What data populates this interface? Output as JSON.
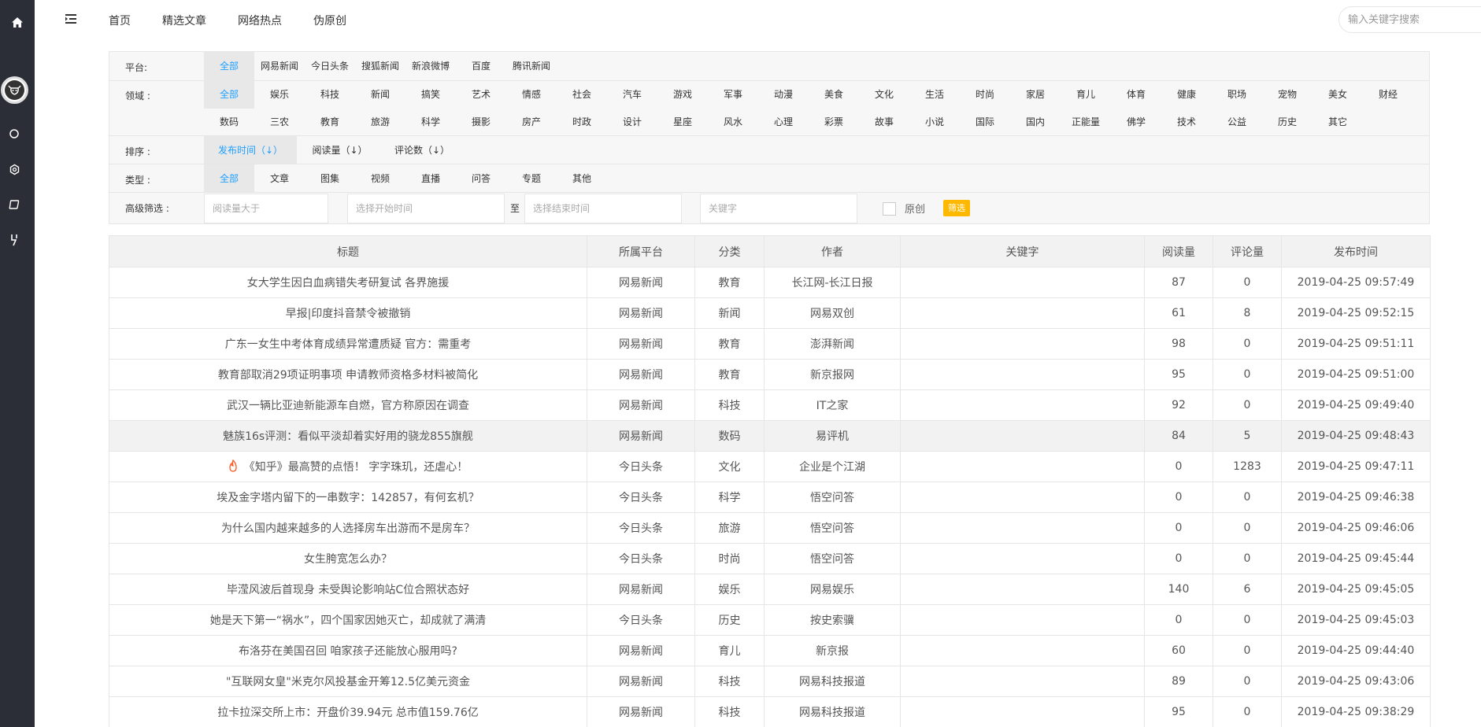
{
  "topbar": {
    "nav": [
      "首页",
      "精选文章",
      "网络热点",
      "伪原创"
    ],
    "search_placeholder": "输入关键字搜索"
  },
  "filters": {
    "platform": {
      "label": "平台:",
      "options": [
        "全部",
        "网易新闻",
        "今日头条",
        "搜狐新闻",
        "新浪微博",
        "百度",
        "腾讯新闻"
      ],
      "selected": 0
    },
    "domain": {
      "label": "领域 :",
      "row1": [
        "全部",
        "娱乐",
        "科技",
        "新闻",
        "搞笑",
        "艺术",
        "情感",
        "社会",
        "汽车",
        "游戏",
        "军事",
        "动漫",
        "美食",
        "文化",
        "生活",
        "时尚",
        "家居",
        "育儿",
        "体育",
        "健康",
        "职场",
        "宠物",
        "美女",
        "财经"
      ],
      "row2": [
        "数码",
        "三农",
        "教育",
        "旅游",
        "科学",
        "摄影",
        "房产",
        "时政",
        "设计",
        "星座",
        "风水",
        "心理",
        "彩票",
        "故事",
        "小说",
        "国际",
        "国内",
        "正能量",
        "佛学",
        "技术",
        "公益",
        "历史",
        "其它"
      ],
      "selected": 0
    },
    "sort": {
      "label": "排序 :",
      "options": [
        "发布时间（↓）",
        "阅读量（↓）",
        "评论数（↓）"
      ],
      "selected": 0
    },
    "type": {
      "label": "类型 :",
      "options": [
        "全部",
        "文章",
        "图集",
        "视频",
        "直播",
        "问答",
        "专题",
        "其他"
      ],
      "selected": 0
    },
    "advanced": {
      "label": "高级筛选 :",
      "reads_placeholder": "阅读量大于",
      "start_placeholder": "选择开始时间",
      "to_label": "至",
      "end_placeholder": "选择结束时间",
      "keyword_placeholder": "关键字",
      "original_label": "原创",
      "filter_button": "筛选"
    }
  },
  "table": {
    "headers": [
      "标题",
      "所属平台",
      "分类",
      "作者",
      "关键字",
      "阅读量",
      "评论量",
      "发布时间"
    ],
    "rows": [
      [
        "女大学生因白血病错失考研复试 各界施援",
        "网易新闻",
        "教育",
        "长江网-长江日报",
        "",
        "87",
        "0",
        "2019-04-25 09:57:49"
      ],
      [
        "早报|印度抖音禁令被撤销",
        "网易新闻",
        "新闻",
        "网易双创",
        "",
        "61",
        "8",
        "2019-04-25 09:52:15"
      ],
      [
        "广东一女生中考体育成绩异常遭质疑 官方：需重考",
        "网易新闻",
        "教育",
        "澎湃新闻",
        "",
        "98",
        "0",
        "2019-04-25 09:51:11"
      ],
      [
        "教育部取消29项证明事项 申请教师资格多材料被简化",
        "网易新闻",
        "教育",
        "新京报网",
        "",
        "95",
        "0",
        "2019-04-25 09:51:00"
      ],
      [
        "武汉一辆比亚迪新能源车自燃，官方称原因在调查",
        "网易新闻",
        "科技",
        "IT之家",
        "",
        "92",
        "0",
        "2019-04-25 09:49:40"
      ],
      [
        "魅族16s评测：看似平淡却着实好用的骁龙855旗舰",
        "网易新闻",
        "数码",
        "易评机",
        "",
        "84",
        "5",
        "2019-04-25 09:48:43"
      ],
      [
        "《知乎》最高赞的点悟！ 字字珠玑，还虐心！",
        "今日头条",
        "文化",
        "企业是个江湖",
        "",
        "0",
        "1283",
        "2019-04-25 09:47:11"
      ],
      [
        "埃及金字塔内留下的一串数字：142857，有何玄机？",
        "今日头条",
        "科学",
        "悟空问答",
        "",
        "0",
        "0",
        "2019-04-25 09:46:38"
      ],
      [
        "为什么国内越来越多的人选择房车出游而不是房车？",
        "今日头条",
        "旅游",
        "悟空问答",
        "",
        "0",
        "0",
        "2019-04-25 09:46:06"
      ],
      [
        "女生胯宽怎么办？",
        "今日头条",
        "时尚",
        "悟空问答",
        "",
        "0",
        "0",
        "2019-04-25 09:45:44"
      ],
      [
        "毕滢风波后首现身 未受舆论影响站C位合照状态好",
        "网易新闻",
        "娱乐",
        "网易娱乐",
        "",
        "140",
        "6",
        "2019-04-25 09:45:05"
      ],
      [
        "她是天下第一“祸水”，四个国家因她灭亡，却成就了满清",
        "今日头条",
        "历史",
        "按史索骥",
        "",
        "0",
        "0",
        "2019-04-25 09:45:03"
      ],
      [
        "布洛芬在美国召回 咱家孩子还能放心服用吗?",
        "网易新闻",
        "育儿",
        "新京报",
        "",
        "60",
        "0",
        "2019-04-25 09:44:40"
      ],
      [
        "\"互联网女皇\"米克尔风投基金开筹12.5亿美元资金",
        "网易新闻",
        "科技",
        "网易科技报道",
        "",
        "89",
        "0",
        "2019-04-25 09:43:06"
      ],
      [
        "拉卡拉深交所上市：开盘价39.94元 总市值159.76亿",
        "网易新闻",
        "科技",
        "网易科技报道",
        "",
        "95",
        "0",
        "2019-04-25 09:38:29"
      ]
    ],
    "highlight_row": 5,
    "fire_row": 6
  },
  "colors": {
    "sidebar": "#2b2e36",
    "accent": "#1e9fff",
    "button": "#ffb800"
  }
}
